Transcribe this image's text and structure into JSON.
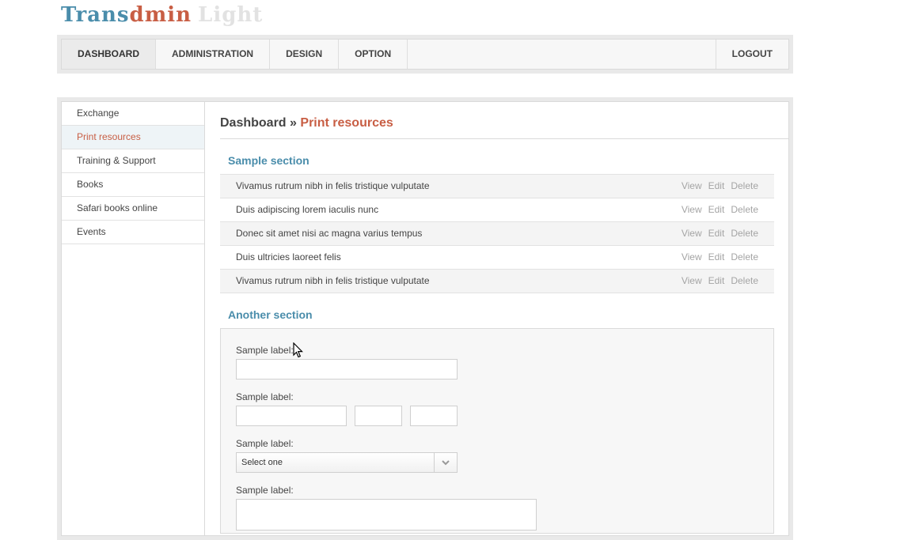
{
  "logo": {
    "part1": "Trans",
    "part2": "dmin",
    "part3": "Light"
  },
  "topnav": {
    "items": [
      {
        "label": "DASHBOARD"
      },
      {
        "label": "ADMINISTRATION"
      },
      {
        "label": "DESIGN"
      },
      {
        "label": "OPTION"
      }
    ],
    "logout": "LOGOUT"
  },
  "sidebar": {
    "items": [
      {
        "label": "Exchange"
      },
      {
        "label": "Print resources"
      },
      {
        "label": "Training & Support"
      },
      {
        "label": "Books"
      },
      {
        "label": "Safari books online"
      },
      {
        "label": "Events"
      }
    ]
  },
  "breadcrumb": {
    "root": "Dashboard",
    "separator": "»",
    "current": "Print resources"
  },
  "section1": {
    "title": "Sample section",
    "rows": [
      {
        "text": "Vivamus rutrum nibh in felis tristique vulputate"
      },
      {
        "text": "Duis adipiscing lorem iaculis nunc"
      },
      {
        "text": "Donec sit amet nisi ac magna varius tempus"
      },
      {
        "text": "Duis ultricies laoreet felis"
      },
      {
        "text": "Vivamus rutrum nibh in felis tristique vulputate"
      }
    ],
    "actions": {
      "view": "View",
      "edit": "Edit",
      "delete": "Delete"
    }
  },
  "section2": {
    "title": "Another section",
    "labels": [
      "Sample label:",
      "Sample label:",
      "Sample label:",
      "Sample label:"
    ],
    "select_value": "Select one"
  },
  "colors": {
    "accent_blue": "#4a8dab",
    "accent_red": "#c85e44"
  }
}
